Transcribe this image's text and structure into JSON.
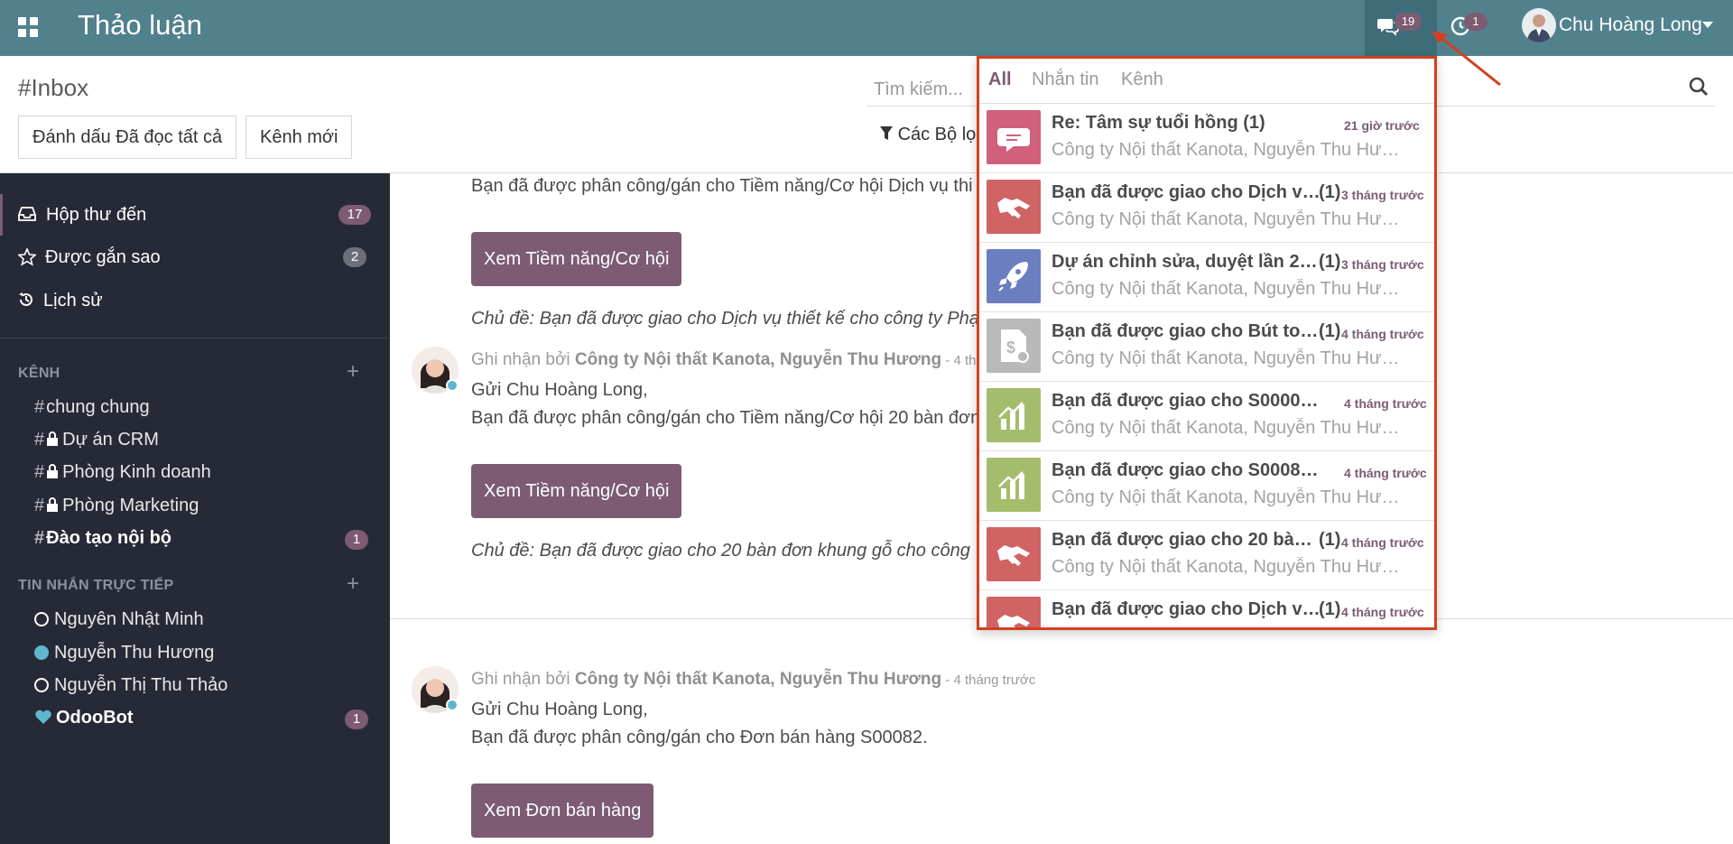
{
  "topbar": {
    "app_title": "Thảo luận",
    "chat_count": "19",
    "activity_count": "1",
    "user_name": "Chu Hoàng Long"
  },
  "control": {
    "breadcrumb": "#Inbox",
    "mark_all_read": "Đánh dấu Đã đọc tất cả",
    "new_channel": "Kênh mới",
    "search_placeholder": "Tìm kiếm...",
    "filters": "Các Bộ lọc"
  },
  "sidebar": {
    "mailboxes": [
      {
        "label": "Hộp thư đến",
        "count": "17"
      },
      {
        "label": "Được gắn sao",
        "count": "2"
      },
      {
        "label": "Lịch sử"
      }
    ],
    "channels_header": "KÊNH",
    "channels": [
      {
        "label": "chung chung"
      },
      {
        "label": "Dự án CRM"
      },
      {
        "label": "Phòng Kinh doanh"
      },
      {
        "label": "Phòng Marketing"
      },
      {
        "label": "Đào tạo nội bộ",
        "count": "1"
      }
    ],
    "dm_header": "TIN NHẮN TRỰC TIẾP",
    "direct_messages": [
      {
        "label": "Nguyên Nhật Minh"
      },
      {
        "label": "Nguyễn Thu Hương"
      },
      {
        "label": "Nguyễn Thị Thu Thảo"
      },
      {
        "label": "OdooBot",
        "count": "1"
      }
    ]
  },
  "thread": {
    "msg1_body": "Bạn đã được phân công/gán cho Tiềm năng/Cơ hội Dịch vụ thi",
    "msg1_button": "Xem Tiềm năng/Cơ hội",
    "msg1_subject": "Chủ đề: Bạn đã được giao cho Dịch vụ thiết kế cho công ty Phạ",
    "msg2_prefix": "Ghi nhận bởi ",
    "msg2_author": "Công ty Nội thất Kanota, Nguyễn Thu Hương",
    "msg2_time": " - 4 th",
    "msg2_greeting": "Gửi Chu Hoàng Long,",
    "msg2_body": "Bạn đã được phân công/gán cho Tiềm năng/Cơ hội 20 bàn đơn",
    "msg2_button": "Xem Tiềm năng/Cơ hội",
    "msg2_subject": "Chủ đề: Bạn đã được giao cho 20 bàn đơn khung gỗ cho công",
    "msg3_prefix": "Ghi nhận bởi ",
    "msg3_author": "Công ty Nội thất Kanota, Nguyễn Thu Hương",
    "msg3_time": " - 4 tháng trước",
    "msg3_greeting": "Gửi Chu Hoàng Long,",
    "msg3_body": "Bạn đã được phân công/gán cho Đơn bán hàng S00082.",
    "msg3_button": "Xem Đơn bán hàng"
  },
  "dropdown": {
    "tabs": [
      "All",
      "Nhắn tin",
      "Kênh"
    ],
    "items": [
      {
        "title": "Re: Tâm sự tuổi hồng (1)",
        "count": "",
        "time": "21 giờ trước",
        "sub": "Công ty Nội thất Kanota, Nguyễn Thu Hươ...",
        "icon": "chat-icon",
        "color": "#d1607c"
      },
      {
        "title": "Bạn đã được giao cho Dịch vụ...",
        "count": "(1)",
        "time": "3 tháng trước",
        "sub": "Công ty Nội thất Kanota, Nguyễn Thu Hươ...",
        "icon": "handshake-icon",
        "color": "#d06364"
      },
      {
        "title": "Dự án chỉnh sửa, duyệt lần 2: ...",
        "count": "(1)",
        "time": "3 tháng trước",
        "sub": "Công ty Nội thất Kanota, Nguyễn Thu Hươ...",
        "icon": "rocket-icon",
        "color": "#6a7ec0"
      },
      {
        "title": "Bạn đã được giao cho Bút toá...",
        "count": "(1)",
        "time": "4 tháng trước",
        "sub": "Công ty Nội thất Kanota, Nguyễn Thu Hươ...",
        "icon": "invoice-icon",
        "color": "#b9b9b9"
      },
      {
        "title": "Bạn đã được giao cho S00008 (1)",
        "count": "",
        "time": "4 tháng trước",
        "sub": "Công ty Nội thất Kanota, Nguyễn Thu Hươ...",
        "icon": "sales-chart-icon",
        "color": "#a4bc6c"
      },
      {
        "title": "Bạn đã được giao cho S00082 (1)",
        "count": "",
        "time": "4 tháng trước",
        "sub": "Công ty Nội thất Kanota, Nguyễn Thu Hươ...",
        "icon": "sales-chart-icon",
        "color": "#a4bc6c"
      },
      {
        "title": "Bạn đã được giao cho 20 bàn ...",
        "count": "(1)",
        "time": "4 tháng trước",
        "sub": "Công ty Nội thất Kanota, Nguyễn Thu Hươ...",
        "icon": "handshake-icon",
        "color": "#d06364"
      },
      {
        "title": "Bạn đã được giao cho Dịch vụ...",
        "count": "(1)",
        "time": "4 tháng trước",
        "sub": "",
        "icon": "handshake-icon",
        "color": "#d06364"
      }
    ]
  }
}
